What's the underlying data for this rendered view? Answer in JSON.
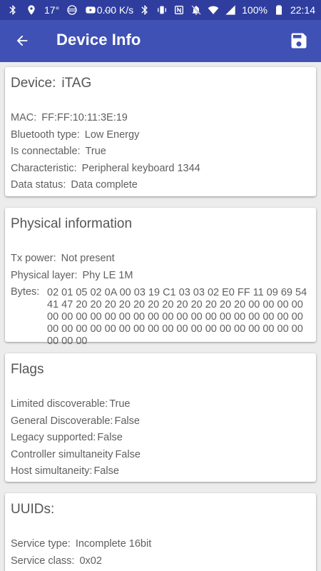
{
  "status_bar": {
    "temperature": "17°",
    "dots": "···",
    "network_speed": "0.00 K/s",
    "battery": "100%",
    "time": "22:14"
  },
  "app_bar": {
    "title": "Device Info",
    "back_icon": "arrow-back-icon",
    "save_icon": "floppy-save-icon"
  },
  "device": {
    "title_label": "Device:",
    "title_value": "iTAG",
    "rows": [
      {
        "label": "MAC:",
        "value": "FF:FF:10:11:3E:19"
      },
      {
        "label": "Bluetooth type:",
        "value": "Low Energy"
      },
      {
        "label": "Is connectable:",
        "value": "True"
      },
      {
        "label": "Characteristic:",
        "value": "Peripheral keyboard 1344"
      },
      {
        "label": "Data status:",
        "value": "Data complete"
      }
    ]
  },
  "physical": {
    "title": "Physical information",
    "rows": [
      {
        "label": "Tx power:",
        "value": "Not present"
      },
      {
        "label": "Physical layer:",
        "value": "Phy LE 1M"
      }
    ],
    "bytes_label": "Bytes:",
    "bytes_value": "02 01 05 02 0A 00 03 19 C1 03 03 02 E0 FF 11 09 69 54 41 47 20 20 20 20 20 20 20 20 20 20 20 20 00 00 00 00 00 00 00 00 00 00 00 00 00 00 00 00 00 00 00 00 00 00 00 00 00 00 00 00 00 00 00 00 00 00 00 00 00 00 00 00 00 00 00"
  },
  "flags": {
    "title": "Flags",
    "rows": [
      {
        "label": "Limited discoverable:",
        "value": "True"
      },
      {
        "label": "General Discoverable:",
        "value": "False"
      },
      {
        "label": "Legacy supported:",
        "value": "False"
      },
      {
        "label": "Controller simultaneity",
        "value": "False"
      },
      {
        "label": "Host simultaneity:",
        "value": "False"
      }
    ]
  },
  "uuids": {
    "title": "UUIDs:",
    "rows": [
      {
        "label": "Service type:",
        "value": "Incomplete 16bit"
      },
      {
        "label": "Service class:",
        "value": "0x02"
      }
    ]
  }
}
